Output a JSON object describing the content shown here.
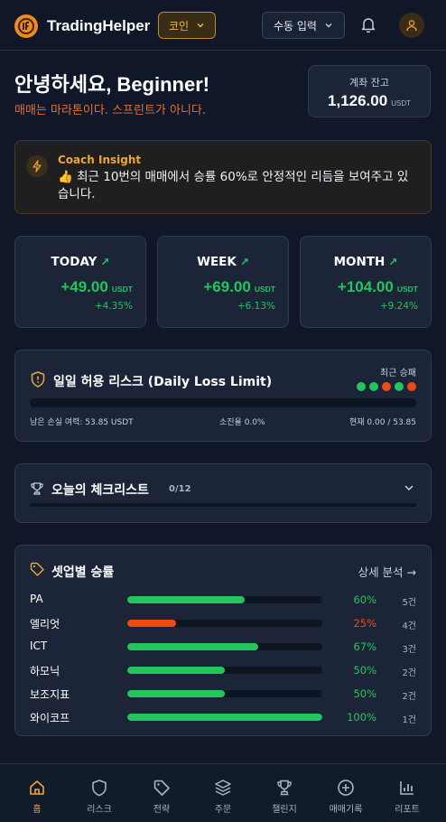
{
  "header": {
    "brand": "TradingHelper",
    "coin_label": "코인",
    "manual_label": "수동 입력"
  },
  "greeting": {
    "title": "안녕하세요, Beginner!",
    "motto": "매매는 마라톤이다. 스프린트가 아니다."
  },
  "balance": {
    "label": "계좌 잔고",
    "value": "1,126.00",
    "unit": "USDT"
  },
  "coach": {
    "title": "Coach Insight",
    "message": "👍 최근 10번의 매매에서 승률 60%로 안정적인 리듬을 보여주고 있습니다."
  },
  "periods": [
    {
      "label": "TODAY",
      "value": "+49.00",
      "unit": "USDT",
      "pct": "+4.35%"
    },
    {
      "label": "WEEK",
      "value": "+69.00",
      "unit": "USDT",
      "pct": "+6.13%"
    },
    {
      "label": "MONTH",
      "value": "+104.00",
      "unit": "USDT",
      "pct": "+9.24%"
    }
  ],
  "risk": {
    "title": "일일 허용 리스크 (Daily Loss Limit)",
    "recent_label": "최근 승패",
    "recent": [
      "win",
      "win",
      "loss",
      "win",
      "loss"
    ],
    "remaining": "남은 손실 여력: 53.85 USDT",
    "used": "소진율 0.0%",
    "current": "현재 0.00 / 53.85",
    "used_fraction": 0
  },
  "checklist": {
    "title": "오늘의 체크리스트",
    "count": "0/12",
    "progress": 0
  },
  "setups": {
    "title": "셋업별 승률",
    "detail": "상세 분석 →",
    "rows": [
      {
        "name": "PA",
        "pct": "60%",
        "value": 60,
        "count": "5건",
        "color": "#22c55e"
      },
      {
        "name": "엘리엇",
        "pct": "25%",
        "value": 25,
        "count": "4건",
        "color": "#f04a14"
      },
      {
        "name": "ICT",
        "pct": "67%",
        "value": 67,
        "count": "3건",
        "color": "#22c55e"
      },
      {
        "name": "하모닉",
        "pct": "50%",
        "value": 50,
        "count": "2건",
        "color": "#22c55e"
      },
      {
        "name": "보조지표",
        "pct": "50%",
        "value": 50,
        "count": "2건",
        "color": "#22c55e"
      },
      {
        "name": "와이코프",
        "pct": "100%",
        "value": 100,
        "count": "1건",
        "color": "#22c55e"
      }
    ]
  },
  "nav": [
    "홈",
    "리스크",
    "전략",
    "주문",
    "챌린지",
    "매매기록",
    "리포트"
  ],
  "colors": {
    "accent": "#f0a53a",
    "win": "#22c55e",
    "loss": "#f04a14",
    "bg": "#0f1728",
    "card": "#1b2537"
  }
}
